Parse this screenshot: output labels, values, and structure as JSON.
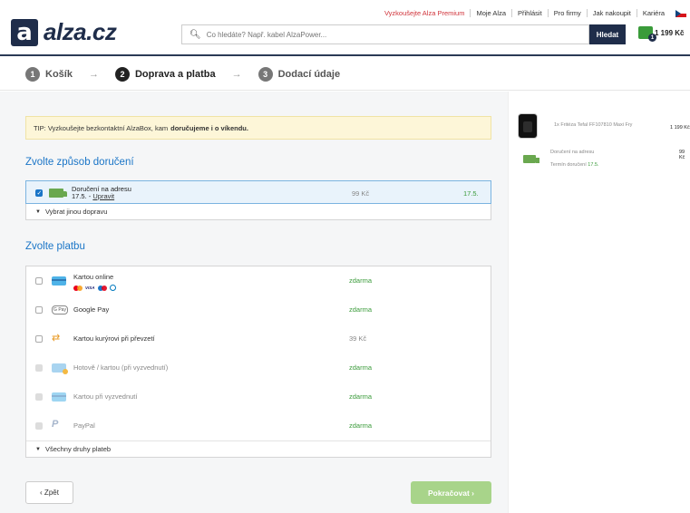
{
  "header": {
    "logo_letter": "a",
    "logo_text": "alza.cz",
    "top_links": [
      "Vyzkoušejte Alza Premium",
      "Moje Alza",
      "Přihlásit",
      "Pro firmy",
      "Jak nakoupit",
      "Kariéra"
    ],
    "search_placeholder": "Co hledáte? Např. kabel AlzaPower...",
    "search_button": "Hledat",
    "cart_count": "1",
    "cart_total": "1 199 Kč"
  },
  "steps": [
    {
      "num": "1",
      "label": "Košík"
    },
    {
      "num": "2",
      "label": "Doprava a platba"
    },
    {
      "num": "3",
      "label": "Dodací údaje"
    }
  ],
  "tip": {
    "prefix": "TIP: Vyzkoušejte bezkontaktní AlzaBox, kam",
    "bold": "doručujeme i o víkendu."
  },
  "delivery": {
    "title": "Zvolte způsob doručení",
    "option_label": "Doručení na adresu",
    "option_date": "17.5. -",
    "edit_link": "Upravit",
    "price": "99 Kč",
    "date": "17.5.",
    "more": "Vybrat jinou dopravu"
  },
  "payment": {
    "title": "Zvolte platbu",
    "options": [
      {
        "label": "Kartou online",
        "price": "zdarma"
      },
      {
        "label": "Google Pay",
        "price": "zdarma"
      },
      {
        "label": "Kartou kurýrovi při převzetí",
        "price": "39 Kč"
      },
      {
        "label": "Hotově / kartou (při vyzvednutí)",
        "price": "zdarma"
      },
      {
        "label": "Kartou při vyzvednutí",
        "price": "zdarma"
      },
      {
        "label": "PayPal",
        "price": "zdarma"
      }
    ],
    "gpay_badge": "G Pay",
    "visa_text": "VISA",
    "more": "Všechny druhy plateb"
  },
  "buttons": {
    "back": "‹ Zpět",
    "next": "Pokračovat ›"
  },
  "summary": {
    "product": "1x Fritéza Tefal FF107810 Maxi Fry",
    "product_price": "1 199 Kč",
    "delivery_label": "Doručení na adresu",
    "delivery_price": "99 Kč",
    "term_label": "Termín doručení",
    "term_date": "17.5."
  }
}
